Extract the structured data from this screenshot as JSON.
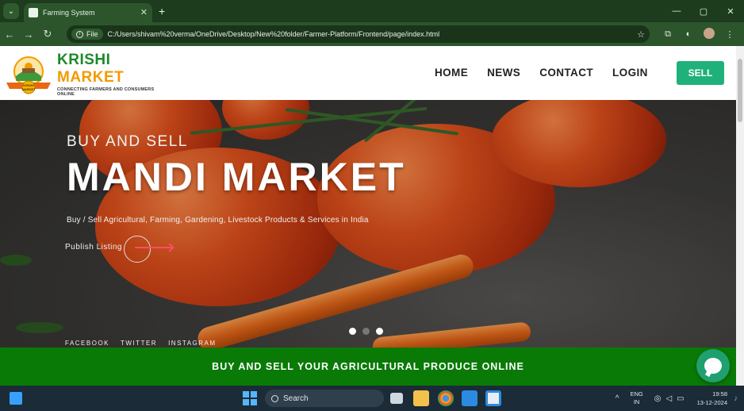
{
  "browser": {
    "tab_title": "Farming System",
    "tab_close": "✕",
    "new_tab": "+",
    "window_controls": {
      "minimize": "—",
      "restore": "▢",
      "close": "✕"
    },
    "address": {
      "scheme_label": "File",
      "url": "C:/Users/shivam%20verma/OneDrive/Desktop/New%20folder/Farmer-Platform/Frontend/page/index.html"
    }
  },
  "site": {
    "logo": {
      "brand_first": "KRISHI",
      "brand_second": "MARKET",
      "tagline": "CONNECTING FARMERS AND CONSUMERS ONLINE",
      "badge_text": "KRISHI MARKET"
    },
    "nav": [
      "HOME",
      "NEWS",
      "CONTACT",
      "LOGIN"
    ],
    "sell_button": "SELL",
    "hero": {
      "eyebrow": "BUY AND SELL",
      "title": "MANDI MARKET",
      "subtitle": "Buy / Sell Agricultural, Farming, Gardening, Livestock Products & Services in India",
      "cta": "Publish Listing",
      "slides": 3,
      "active_slide": 2,
      "social": [
        "FACEBOOK",
        "TWITTER",
        "INSTAGRAM"
      ]
    },
    "banner": "BUY AND SELL YOUR AGRICULTURAL PRODUCE ONLINE",
    "colors": {
      "brand_green": "#1c8a2a",
      "brand_orange": "#f29a00",
      "sell_button": "#20b07a",
      "banner": "#0a7a07",
      "cta_arrow": "#ff4d6a"
    }
  },
  "taskbar": {
    "search_placeholder": "Search",
    "lang_line1": "ENG",
    "lang_line2": "IN",
    "time": "19:58",
    "date": "13-12-2024"
  }
}
